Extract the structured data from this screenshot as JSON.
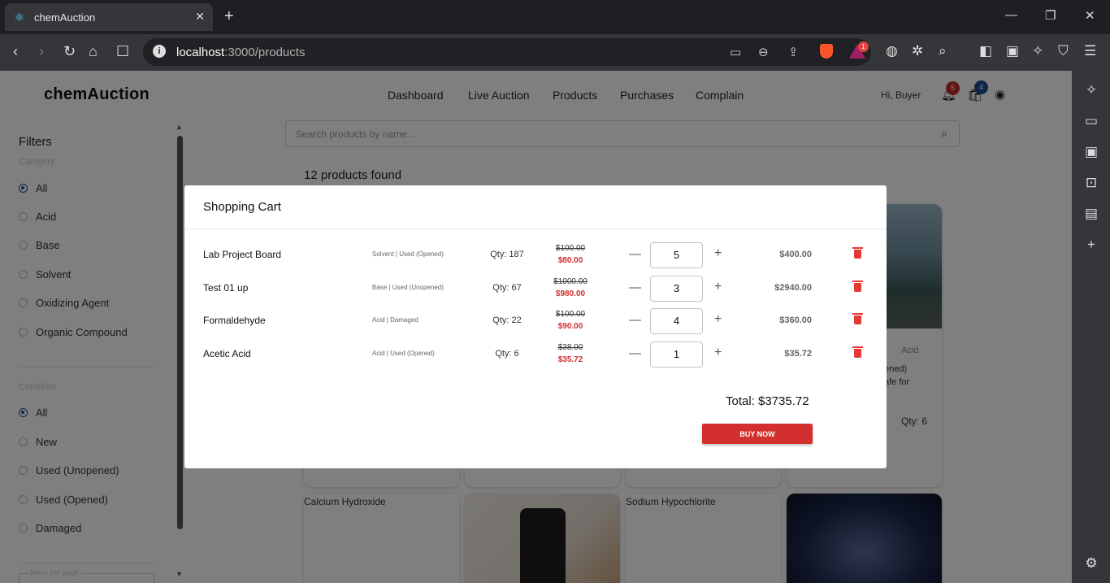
{
  "browser": {
    "tab_title": "chemAuction",
    "url_host": "localhost",
    "url_path": ":3000/products",
    "bat_badge": "1"
  },
  "header": {
    "brand": "chemAuction",
    "nav": [
      "Dashboard",
      "Live Auction",
      "Products",
      "Purchases",
      "Complain"
    ],
    "greeting": "Hi, Buyer",
    "notification_count": "5",
    "cart_count": "4"
  },
  "filters": {
    "title": "Filters",
    "category_label": "Category",
    "categories": [
      "All",
      "Acid",
      "Base",
      "Solvent",
      "Oxidizing Agent",
      "Organic Compound"
    ],
    "condition_label": "Condition",
    "conditions": [
      "All",
      "New",
      "Used (Unopened)",
      "Used (Opened)",
      "Damaged"
    ],
    "per_page_label": "Items per page"
  },
  "search": {
    "placeholder": "Search products by name..."
  },
  "results": {
    "count_text": "12 products found"
  },
  "cards": {
    "right_category": "Acid",
    "right_condition": "ened)",
    "right_desc": "afe for",
    "right_qty": "Qty: 6",
    "bottom_alts": [
      "Calcium Hydroxide",
      "Sodium Hypochlorite"
    ]
  },
  "cart": {
    "title": "Shopping Cart",
    "items": [
      {
        "name": "Lab Project Board",
        "meta": "Solvent | Used (Opened)",
        "qty": "Qty: 187",
        "old_price": "$100.00",
        "new_price": "$80.00",
        "quantity": "5",
        "subtotal": "$400.00"
      },
      {
        "name": "Test 01 up",
        "meta": "Base | Used (Unopened)",
        "qty": "Qty: 67",
        "old_price": "$1000.00",
        "new_price": "$980.00",
        "quantity": "3",
        "subtotal": "$2940.00"
      },
      {
        "name": "Formaldehyde",
        "meta": "Acid | Damaged",
        "qty": "Qty: 22",
        "old_price": "$100.00",
        "new_price": "$90.00",
        "quantity": "4",
        "subtotal": "$360.00"
      },
      {
        "name": "Acetic Acid",
        "meta": "Acid | Used (Opened)",
        "qty": "Qty: 6",
        "old_price": "$38.00",
        "new_price": "$35.72",
        "quantity": "1",
        "subtotal": "$35.72"
      }
    ],
    "minus_glyph": "—",
    "plus_glyph": "+",
    "total": "Total: $3735.72",
    "buy_label": "BUY NOW"
  },
  "colors": {
    "accent_red": "#d32f2f",
    "radio_selected": "#1a4d8f",
    "notif_badge": "#c62828",
    "cart_badge": "#1a4d8f"
  }
}
